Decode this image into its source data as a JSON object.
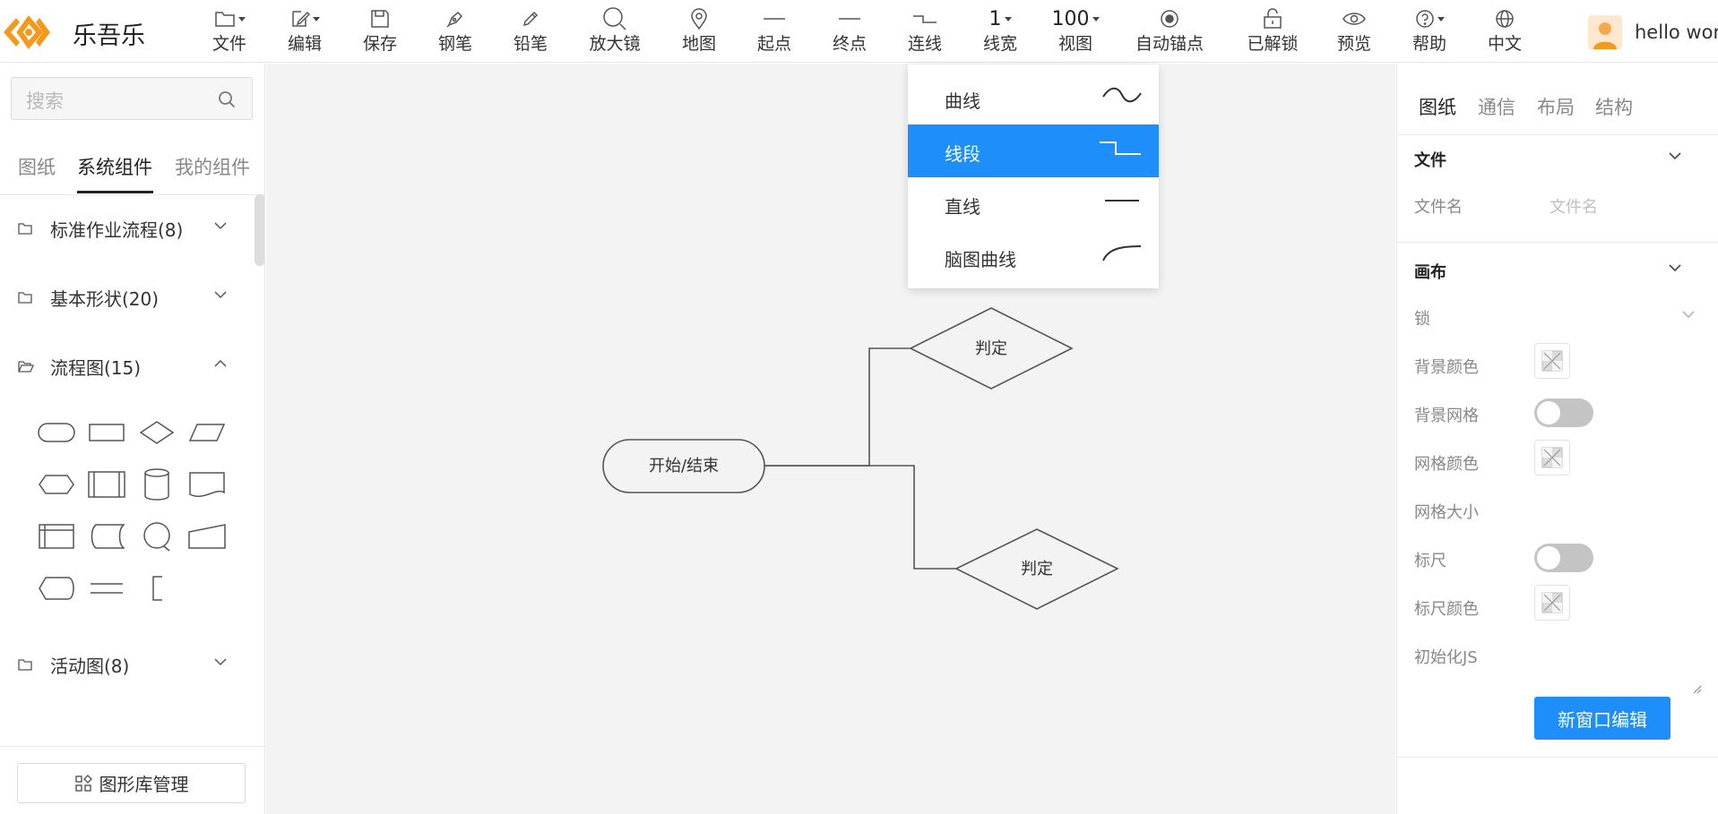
{
  "app": {
    "brand": "乐吾乐"
  },
  "toolbar": {
    "file": "文件",
    "edit": "编辑",
    "save": "保存",
    "pen": "钢笔",
    "pencil": "铅笔",
    "magnifier": "放大镜",
    "map": "地图",
    "start_point": "起点",
    "end_point": "终点",
    "connect": "连线",
    "line_width": "线宽",
    "line_width_value": "1",
    "view": "视图",
    "view_value": "100",
    "auto_anchor": "自动锚点",
    "unlocked": "已解锁",
    "preview": "预览",
    "help": "帮助",
    "language": "中文"
  },
  "user": {
    "name": "hello world"
  },
  "left": {
    "search_placeholder": "搜索",
    "tabs": [
      "图纸",
      "系统组件",
      "我的组件"
    ],
    "active_tab": "系统组件",
    "categories": [
      {
        "label": "标准作业流程(8)",
        "expanded": false
      },
      {
        "label": "基本形状(20)",
        "expanded": false
      },
      {
        "label": "流程图(15)",
        "expanded": true
      },
      {
        "label": "活动图(8)",
        "expanded": false
      }
    ],
    "shape_icons": [
      "terminator-shape-icon",
      "process-shape-icon",
      "decision-shape-icon",
      "data-shape-icon",
      "preparation-shape-icon",
      "subprocess-shape-icon",
      "database-shape-icon",
      "document-shape-icon",
      "internal-storage-shape-icon",
      "stored-data-shape-icon",
      "connector-shape-icon",
      "manual-input-shape-icon",
      "display-shape-icon",
      "parallel-shape-icon",
      "comment-shape-icon"
    ],
    "library_button": "图形库管理"
  },
  "canvas": {
    "nodes": {
      "start_end": "开始/结束",
      "decision_top": "判定",
      "decision_bottom": "判定"
    }
  },
  "line_type_menu": {
    "items": [
      {
        "label": "曲线",
        "icon": "curve-line-icon"
      },
      {
        "label": "线段",
        "icon": "polyline-icon"
      },
      {
        "label": "直线",
        "icon": "straight-line-icon"
      },
      {
        "label": "脑图曲线",
        "icon": "mind-curve-icon"
      }
    ],
    "selected": "线段"
  },
  "right": {
    "tabs": [
      "图纸",
      "通信",
      "布局",
      "结构"
    ],
    "active_tab": "图纸",
    "file_section": {
      "title": "文件",
      "filename_label": "文件名",
      "filename_placeholder": "文件名"
    },
    "canvas_section": {
      "title": "画布",
      "lock": "锁",
      "bg_color": "背景颜色",
      "bg_grid": "背景网格",
      "bg_grid_on": false,
      "grid_color": "网格颜色",
      "grid_size": "网格大小",
      "ruler": "标尺",
      "ruler_on": false,
      "ruler_color": "标尺颜色",
      "init_js": "初始化JS",
      "open_editor": "新窗口编辑"
    }
  },
  "colors": {
    "accent": "#1e8ffa",
    "brand_orange": "#f39a1c",
    "canvas_bg": "#f3f3f3"
  }
}
